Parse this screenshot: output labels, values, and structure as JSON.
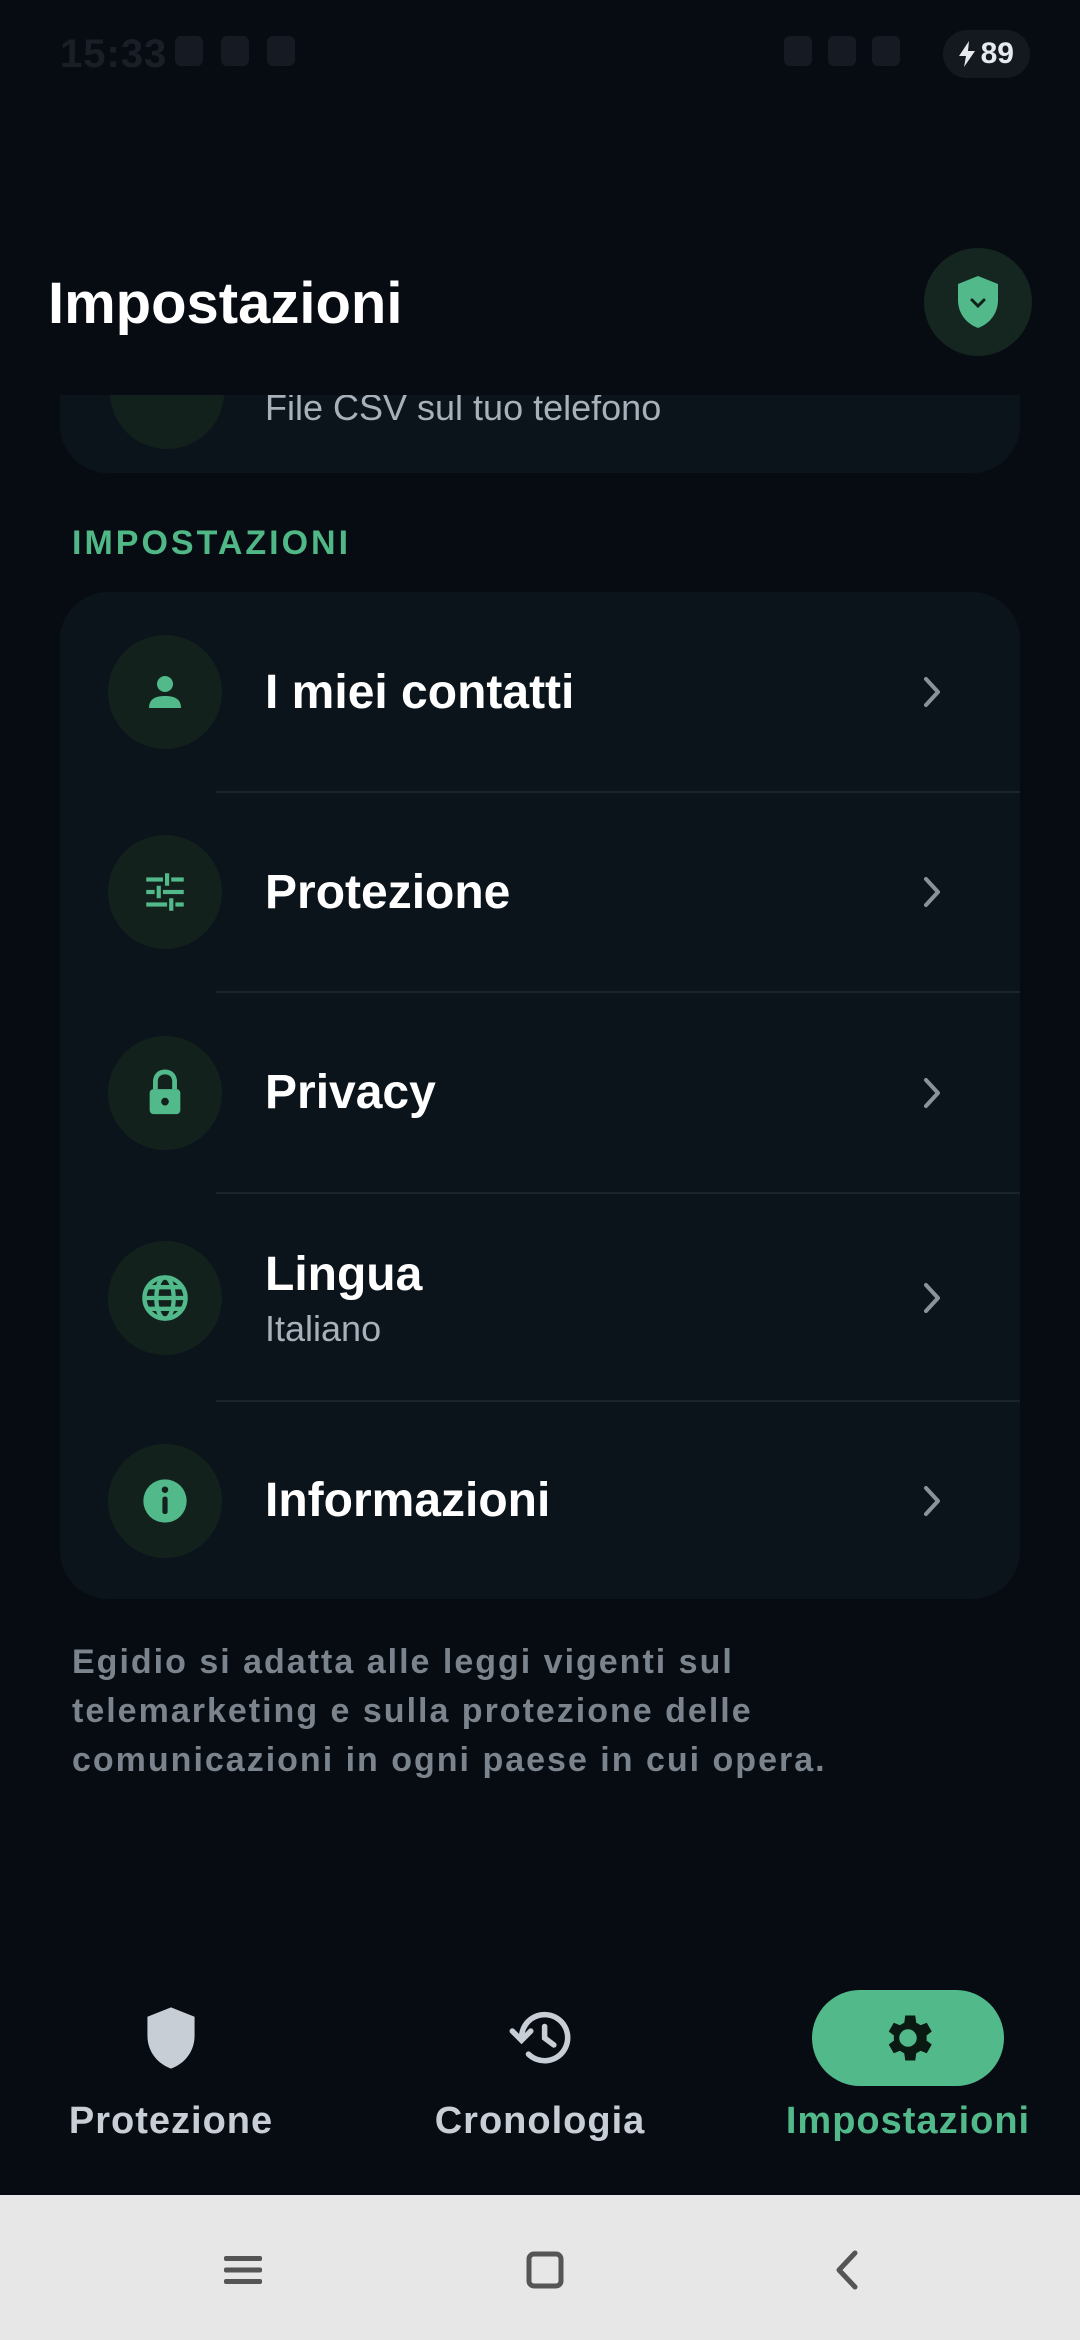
{
  "status_bar": {
    "time": "15:33",
    "battery": "89"
  },
  "header": {
    "title": "Impostazioni"
  },
  "previous_item": {
    "subtitle": "File CSV sul tuo telefono"
  },
  "section": {
    "title": "IMPOSTAZIONI"
  },
  "settings": {
    "items": [
      {
        "label": "I miei contatti",
        "icon": "person-icon"
      },
      {
        "label": "Protezione",
        "icon": "tune-icon"
      },
      {
        "label": "Privacy",
        "icon": "lock-icon"
      },
      {
        "label": "Lingua",
        "sublabel": "Italiano",
        "icon": "globe-icon"
      },
      {
        "label": "Informazioni",
        "icon": "info-icon"
      }
    ]
  },
  "footer_note": "Egidio si adatta alle leggi vigenti sul telemarketing e sulla protezione delle comunicazioni in ogni paese in cui opera.",
  "bottom_nav": {
    "items": [
      {
        "label": "Protezione",
        "icon": "shield-icon",
        "active": false
      },
      {
        "label": "Cronologia",
        "icon": "history-icon",
        "active": false
      },
      {
        "label": "Impostazioni",
        "icon": "gear-icon",
        "active": true
      }
    ]
  },
  "colors": {
    "background": "#070c13",
    "card": "#0c141b",
    "accent": "#52b98b",
    "icon_bg": "#13211d"
  }
}
